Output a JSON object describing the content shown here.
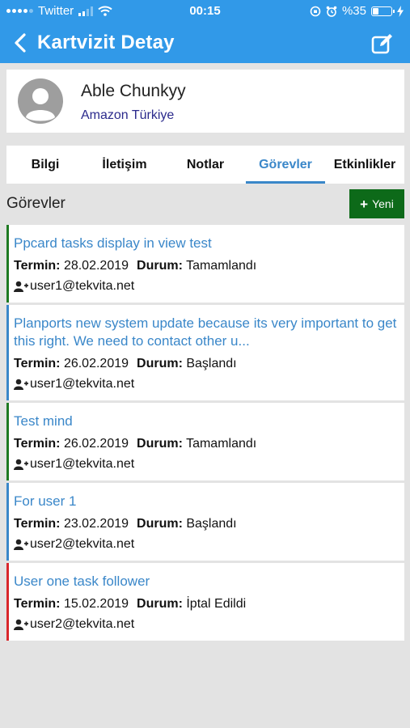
{
  "status_bar": {
    "carrier": "Twitter",
    "time": "00:15",
    "battery": "%35",
    "battery_level": 0.35
  },
  "nav": {
    "title": "Kartvizit Detay",
    "back_icon": "chevron-left-icon",
    "edit_icon": "edit-icon"
  },
  "contact": {
    "name": "Able Chunkyy",
    "company": "Amazon Türkiye"
  },
  "tabs": [
    {
      "label": "Bilgi",
      "active": false
    },
    {
      "label": "İletişim",
      "active": false
    },
    {
      "label": "Notlar",
      "active": false
    },
    {
      "label": "Görevler",
      "active": true
    },
    {
      "label": "Etkinlikler",
      "active": false
    }
  ],
  "section": {
    "title": "Görevler",
    "new_button": "Yeni"
  },
  "labels": {
    "due": "Termin:",
    "status": "Durum:"
  },
  "tasks": [
    {
      "title": "Ppcard tasks display in view test",
      "due": "28.02.2019",
      "status": "Tamamlandı",
      "user": "user1@tekvita.net",
      "color": "#1e7a22"
    },
    {
      "title": "Planports new system update because its very important to get this right. We need to contact other u...",
      "due": "26.02.2019",
      "status": "Başlandı",
      "user": "user1@tekvita.net",
      "color": "#3a87c9"
    },
    {
      "title": "Test mind",
      "due": "26.02.2019",
      "status": "Tamamlandı",
      "user": "user1@tekvita.net",
      "color": "#1e7a22"
    },
    {
      "title": "For user 1",
      "due": "23.02.2019",
      "status": "Başlandı",
      "user": "user2@tekvita.net",
      "color": "#3a87c9"
    },
    {
      "title": "User one task follower",
      "due": "15.02.2019",
      "status": "İptal Edildi",
      "user": "user2@tekvita.net",
      "color": "#d9262b"
    }
  ]
}
